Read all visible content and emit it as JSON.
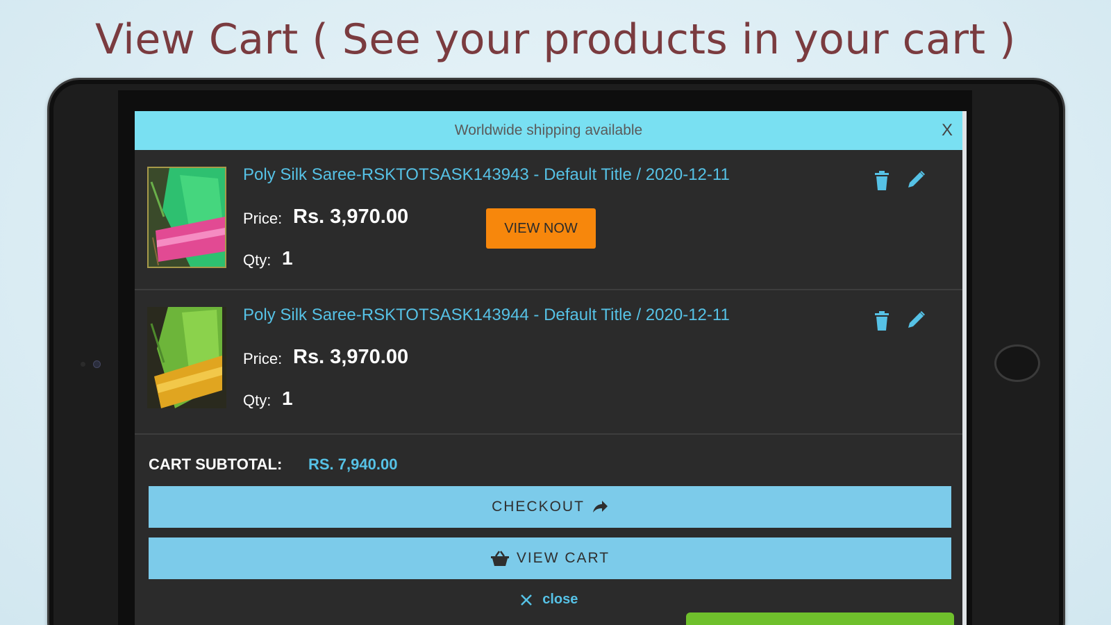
{
  "headline": "View Cart ( See your products in your cart )",
  "cart_popup": {
    "banner_text": "Worldwide shipping available",
    "close_x": "X",
    "price_label": "Price:",
    "qty_label": "Qty:",
    "view_now_label": "VIEW NOW",
    "items": [
      {
        "title": "Poly Silk Saree-RSKTOTSASK143943 - Default Title / 2020-12-11",
        "price": "Rs. 3,970.00",
        "qty": "1"
      },
      {
        "title": "Poly Silk Saree-RSKTOTSASK143944 - Default Title / 2020-12-11",
        "price": "Rs. 3,970.00",
        "qty": "1"
      }
    ],
    "subtotal_label": "CART SUBTOTAL:",
    "subtotal_value": "RS. 7,940.00",
    "checkout_label": "CHECKOUT",
    "view_cart_label": "VIEW CART",
    "close_label": "close"
  },
  "colors": {
    "banner": "#79e0f2",
    "accent_text": "#56c2e6",
    "view_now": "#f7870c",
    "action_button": "#7ccbea",
    "headline": "#7a3b3f"
  },
  "icons": [
    "trash-icon",
    "pencil-icon",
    "share-arrow-icon",
    "basket-icon",
    "close-x-icon"
  ]
}
